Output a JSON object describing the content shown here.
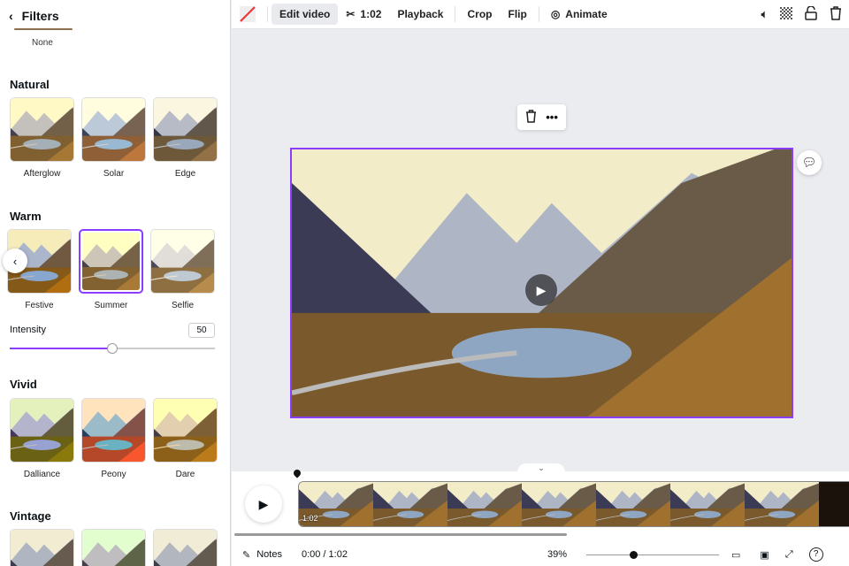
{
  "panel": {
    "title": "Filters",
    "none_label": "None",
    "sections": [
      {
        "title": "Natural",
        "items": [
          "Afterglow",
          "Solar",
          "Edge"
        ]
      },
      {
        "title": "Warm",
        "items": [
          "Festive",
          "Summer",
          "Selfie"
        ],
        "selected": "Summer"
      },
      {
        "title": "Vivid",
        "items": [
          "Dalliance",
          "Peony",
          "Dare"
        ]
      },
      {
        "title": "Vintage",
        "items": [
          "",
          "",
          ""
        ]
      }
    ],
    "intensity_label": "Intensity",
    "intensity_value": "50",
    "intensity_fraction": 0.5
  },
  "toolbar": {
    "edit_video": "Edit video",
    "duration": "1:02",
    "playback": "Playback",
    "crop": "Crop",
    "flip": "Flip",
    "animate": "Animate"
  },
  "timeline": {
    "clip_duration": "1:02"
  },
  "bottom": {
    "notes": "Notes",
    "time": "0:00 / 1:02",
    "zoom": "39%",
    "zoom_fraction": 0.35
  },
  "colors": {
    "accent": "#8b3dff"
  }
}
